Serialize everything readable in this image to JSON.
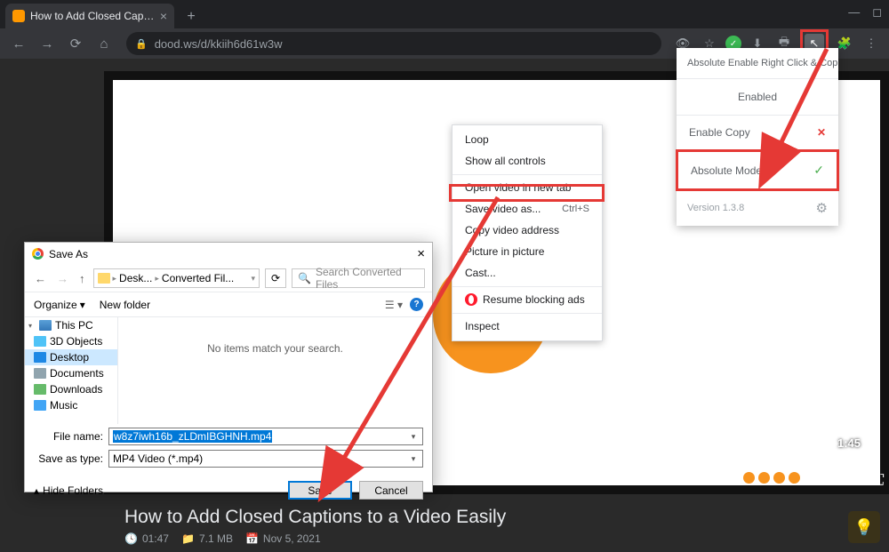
{
  "browser": {
    "tab_title": "How to Add Closed Captions to ...",
    "url": "dood.ws/d/kkiih6d61w3w"
  },
  "context_menu": {
    "loop": "Loop",
    "show_controls": "Show all controls",
    "open_new_tab": "Open video in new tab",
    "save_video": "Save video as...",
    "save_shortcut": "Ctrl+S",
    "copy_address": "Copy video address",
    "pip": "Picture in picture",
    "cast": "Cast...",
    "resume_block": "Resume blocking ads",
    "inspect": "Inspect"
  },
  "extension": {
    "name": "Absolute Enable Right Click & Cop",
    "status": "Enabled",
    "enable_copy": "Enable Copy",
    "absolute_mode": "Absolute Mode",
    "version": "Version 1.3.8"
  },
  "save_dialog": {
    "title": "Save As",
    "crumb1": "Desk...",
    "crumb2": "Converted Fil...",
    "search_placeholder": "Search Converted Files",
    "organize": "Organize",
    "new_folder": "New folder",
    "tree": {
      "this_pc": "This PC",
      "objects_3d": "3D Objects",
      "desktop": "Desktop",
      "documents": "Documents",
      "downloads": "Downloads",
      "music": "Music"
    },
    "empty": "No items match your search.",
    "filename_label": "File name:",
    "filename_value": "w8z7iwh16b_zLDmIBGHNH.mp4",
    "saveastype_label": "Save as type:",
    "saveastype_value": "MP4 Video (*.mp4)",
    "hide_folders": "Hide Folders",
    "save": "Save",
    "cancel": "Cancel"
  },
  "video": {
    "title": "How to Add Closed Captions to a Video Easily",
    "duration": "01:47",
    "size": "7.1 MB",
    "date": "Nov 5, 2021",
    "time_overlay": "1:45"
  }
}
